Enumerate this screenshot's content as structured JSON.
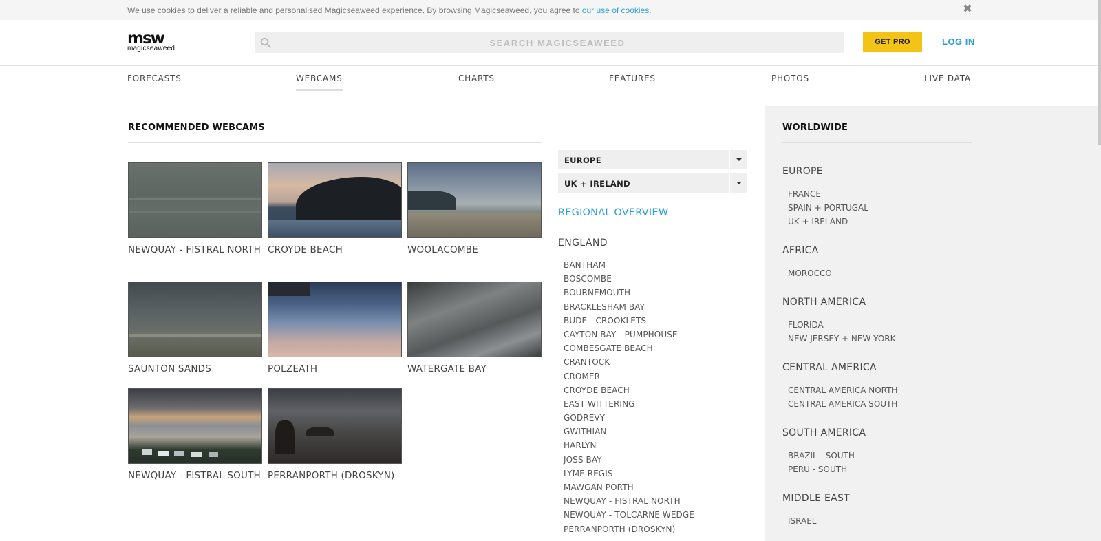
{
  "cookie_bar": {
    "text": "We use cookies to deliver a reliable and personalised Magicseaweed experience. By browsing Magicseaweed, you agree to ",
    "link": "our use of cookies.",
    "close": "✖"
  },
  "header": {
    "logo_mark": "msw",
    "logo_word": "magicseaweed",
    "search_placeholder": "SEARCH MAGICSEAWEED",
    "get_pro": "GET PRO",
    "log_in": "LOG IN"
  },
  "nav": [
    {
      "label": "FORECASTS"
    },
    {
      "label": "WEBCAMS"
    },
    {
      "label": "CHARTS"
    },
    {
      "label": "FEATURES"
    },
    {
      "label": "PHOTOS"
    },
    {
      "label": "LIVE DATA"
    }
  ],
  "recommended": {
    "title": "RECOMMENDED WEBCAMS",
    "cams": [
      {
        "name": "NEWQUAY - FISTRAL NORTH"
      },
      {
        "name": "CROYDE BEACH"
      },
      {
        "name": "WOOLACOMBE"
      },
      {
        "name": "SAUNTON SANDS"
      },
      {
        "name": "POLZEATH"
      },
      {
        "name": "WATERGATE BAY"
      },
      {
        "name": "NEWQUAY - FISTRAL SOUTH"
      },
      {
        "name": "PERRANPORTH (DROSKYN)"
      }
    ]
  },
  "filters": {
    "continent": "EUROPE",
    "region": "UK + IRELAND",
    "regional_overview": "REGIONAL OVERVIEW",
    "area": "ENGLAND",
    "spots": [
      "BANTHAM",
      "BOSCOMBE",
      "BOURNEMOUTH",
      "BRACKLESHAM BAY",
      "BUDE - CROOKLETS",
      "CAYTON BAY - PUMPHOUSE",
      "COMBESGATE BEACH",
      "CRANTOCK",
      "CROMER",
      "CROYDE BEACH",
      "EAST WITTERING",
      "GODREVY",
      "GWITHIAN",
      "HARLYN",
      "JOSS BAY",
      "LYME REGIS",
      "MAWGAN PORTH",
      "NEWQUAY - FISTRAL NORTH",
      "NEWQUAY - TOLCARNE WEDGE",
      "PERRANPORTH (DROSKYN)"
    ]
  },
  "worldwide": {
    "title": "WORLDWIDE",
    "regions": [
      {
        "name": "EUROPE",
        "countries": [
          "FRANCE",
          "SPAIN + PORTUGAL",
          "UK + IRELAND"
        ]
      },
      {
        "name": "AFRICA",
        "countries": [
          "MOROCCO"
        ]
      },
      {
        "name": "NORTH AMERICA",
        "countries": [
          "FLORIDA",
          "NEW JERSEY + NEW YORK"
        ]
      },
      {
        "name": "CENTRAL AMERICA",
        "countries": [
          "CENTRAL AMERICA NORTH",
          "CENTRAL AMERICA SOUTH"
        ]
      },
      {
        "name": "SOUTH AMERICA",
        "countries": [
          "BRAZIL - SOUTH",
          "PERU - SOUTH"
        ]
      },
      {
        "name": "MIDDLE EAST",
        "countries": [
          "ISRAEL"
        ]
      }
    ]
  },
  "colors": {
    "accent_blue": "#2a9fd8",
    "pro_yellow": "#f3c315",
    "panel_grey": "#f1f1f1"
  }
}
